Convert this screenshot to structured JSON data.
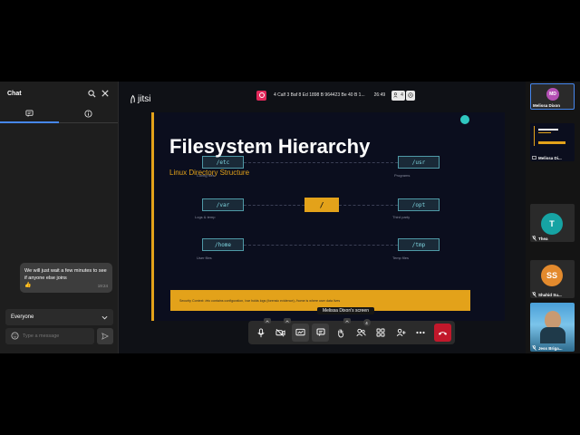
{
  "chat": {
    "title": "Chat",
    "message": {
      "text": "We will just wait a few minutes to see if anyone else joins",
      "emoji": "👍",
      "time": "19:24"
    },
    "recipient": "Everyone",
    "input_placeholder": "Type a message"
  },
  "meeting": {
    "logo": "jitsi",
    "room_name": "4 Calf 3 Baf 8 Ed 1898 B 964423 Be 40 B 1...",
    "timer": "26:49",
    "participant_count": "4"
  },
  "slide": {
    "title": "Filesystem Hierarchy",
    "subtitle": "Linux Directory Structure",
    "root": "/",
    "dirs": [
      {
        "path": "/etc",
        "caption": "Config files"
      },
      {
        "path": "/usr",
        "caption": "Programs"
      },
      {
        "path": "/var",
        "caption": "Logs & temp"
      },
      {
        "path": "/opt",
        "caption": "Third party"
      },
      {
        "path": "/home",
        "caption": "User files"
      },
      {
        "path": "/tmp",
        "caption": "Temp files"
      }
    ],
    "context": "Security Context: /etc contains configuration, /var holds logs (forensic evidence), /home is where user data lives",
    "accent": "#e3a21a"
  },
  "screen_label": "Melissa Dixon's screen",
  "toolbar": {
    "participants_badge": "4",
    "hangup_color": "#c2182b"
  },
  "participants": [
    {
      "initials": "MD",
      "name": "Melissa Dixon",
      "color": "#b34fb3"
    },
    {
      "initials": "",
      "name": "Melissa Di...",
      "color": ""
    },
    {
      "initials": "T",
      "name": "Thea",
      "color": "#16a3a3"
    },
    {
      "initials": "SS",
      "name": "Shahid Su...",
      "color": "#e38a2d"
    },
    {
      "initials": "",
      "name": "Jess Briga...",
      "color": ""
    }
  ]
}
